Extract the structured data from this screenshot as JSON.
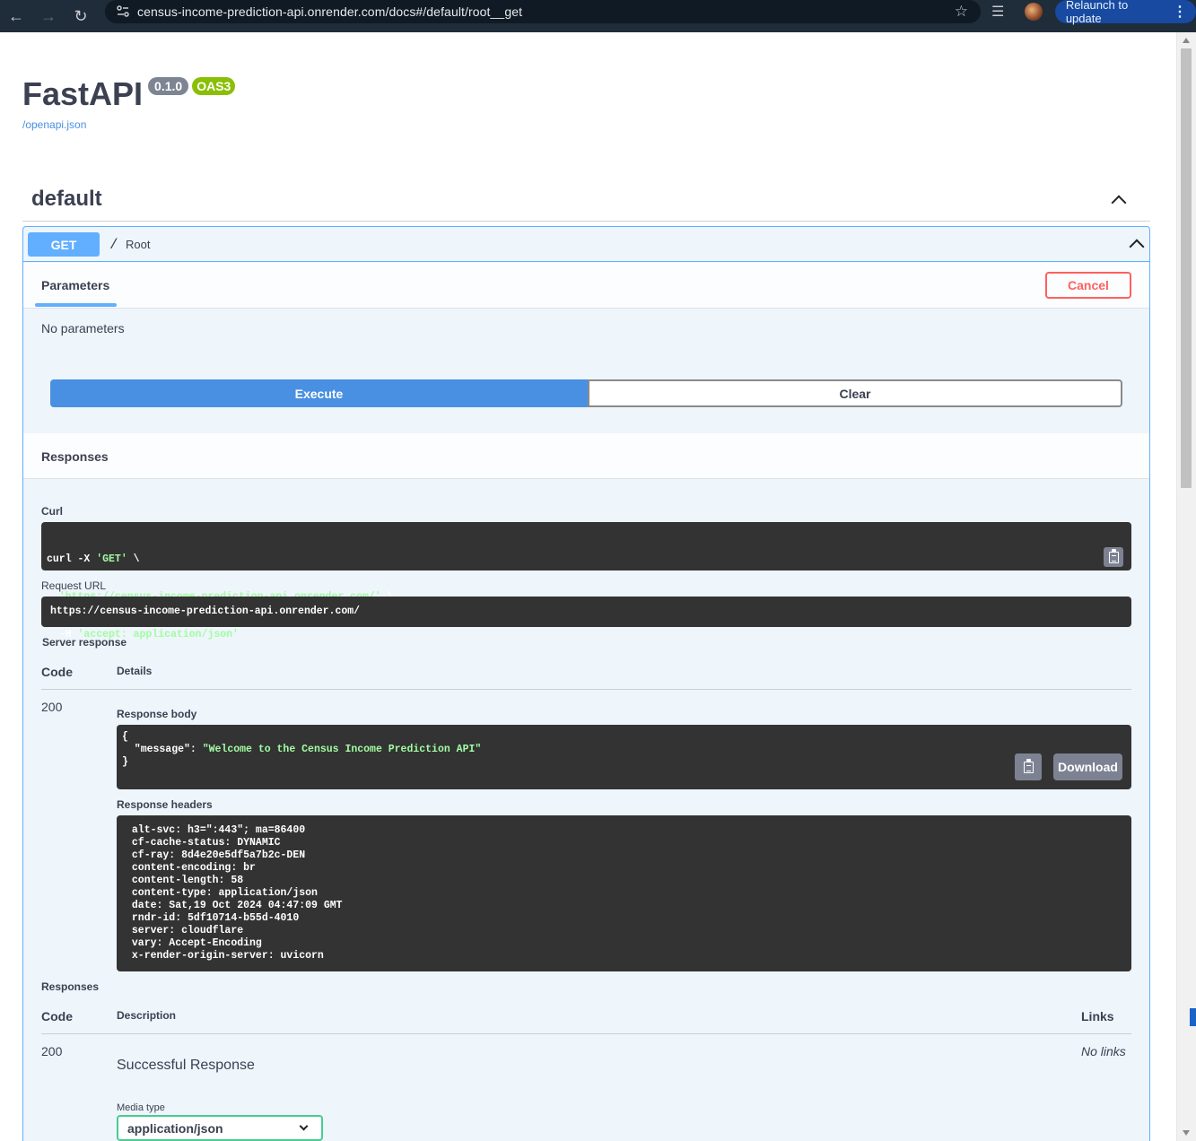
{
  "browser": {
    "url": "census-income-prediction-api.onrender.com/docs#/default/root__get",
    "relaunch_label": "Relaunch to update"
  },
  "info": {
    "title": "FastAPI",
    "version": "0.1.0",
    "oas": "OAS3",
    "spec_link": "/openapi.json"
  },
  "tag": {
    "name": "default"
  },
  "operation": {
    "method": "GET",
    "path": "/",
    "summary": "Root",
    "parameters_tab": "Parameters",
    "cancel_label": "Cancel",
    "no_params": "No parameters",
    "execute_label": "Execute",
    "clear_label": "Clear",
    "responses_title": "Responses"
  },
  "live": {
    "curl_label": "Curl",
    "curl_lines": [
      {
        "plain": "curl -X ",
        "str": "'GET'",
        "tail": " \\"
      },
      {
        "plain": "  ",
        "str": "'https://census-income-prediction-api.onrender.com/'",
        "tail": " \\"
      },
      {
        "plain": "  -H ",
        "str": "'accept: application/json'",
        "tail": ""
      }
    ],
    "request_url_label": "Request URL",
    "request_url": "https://census-income-prediction-api.onrender.com/",
    "server_response_label": "Server response",
    "code_header": "Code",
    "details_header": "Details",
    "status_code": "200",
    "response_body_label": "Response body",
    "body_open": "{",
    "body_key": "  \"message\": ",
    "body_value": "\"Welcome to the Census Income Prediction API\"",
    "body_close": "}",
    "download_label": "Download",
    "response_headers_label": "Response headers",
    "headers": [
      " alt-svc: h3=\":443\"; ma=86400",
      " cf-cache-status: DYNAMIC",
      " cf-ray: 8d4e20e5df5a7b2c-DEN",
      " content-encoding: br",
      " content-length: 58",
      " content-type: application/json",
      " date: Sat,19 Oct 2024 04:47:09 GMT",
      " rndr-id: 5df10714-b55d-4010",
      " server: cloudflare",
      " vary: Accept-Encoding",
      " x-render-origin-server: uvicorn"
    ]
  },
  "documented": {
    "responses_label": "Responses",
    "code_header": "Code",
    "description_header": "Description",
    "links_header": "Links",
    "code": "200",
    "description": "Successful Response",
    "links": "No links",
    "media_type_label": "Media type",
    "media_type": "application/json"
  },
  "colors": {
    "get": "#61affe",
    "execute": "#4990e2",
    "cancel": "#ff6060",
    "oas": "#89bf04",
    "version": "#7d8492"
  }
}
